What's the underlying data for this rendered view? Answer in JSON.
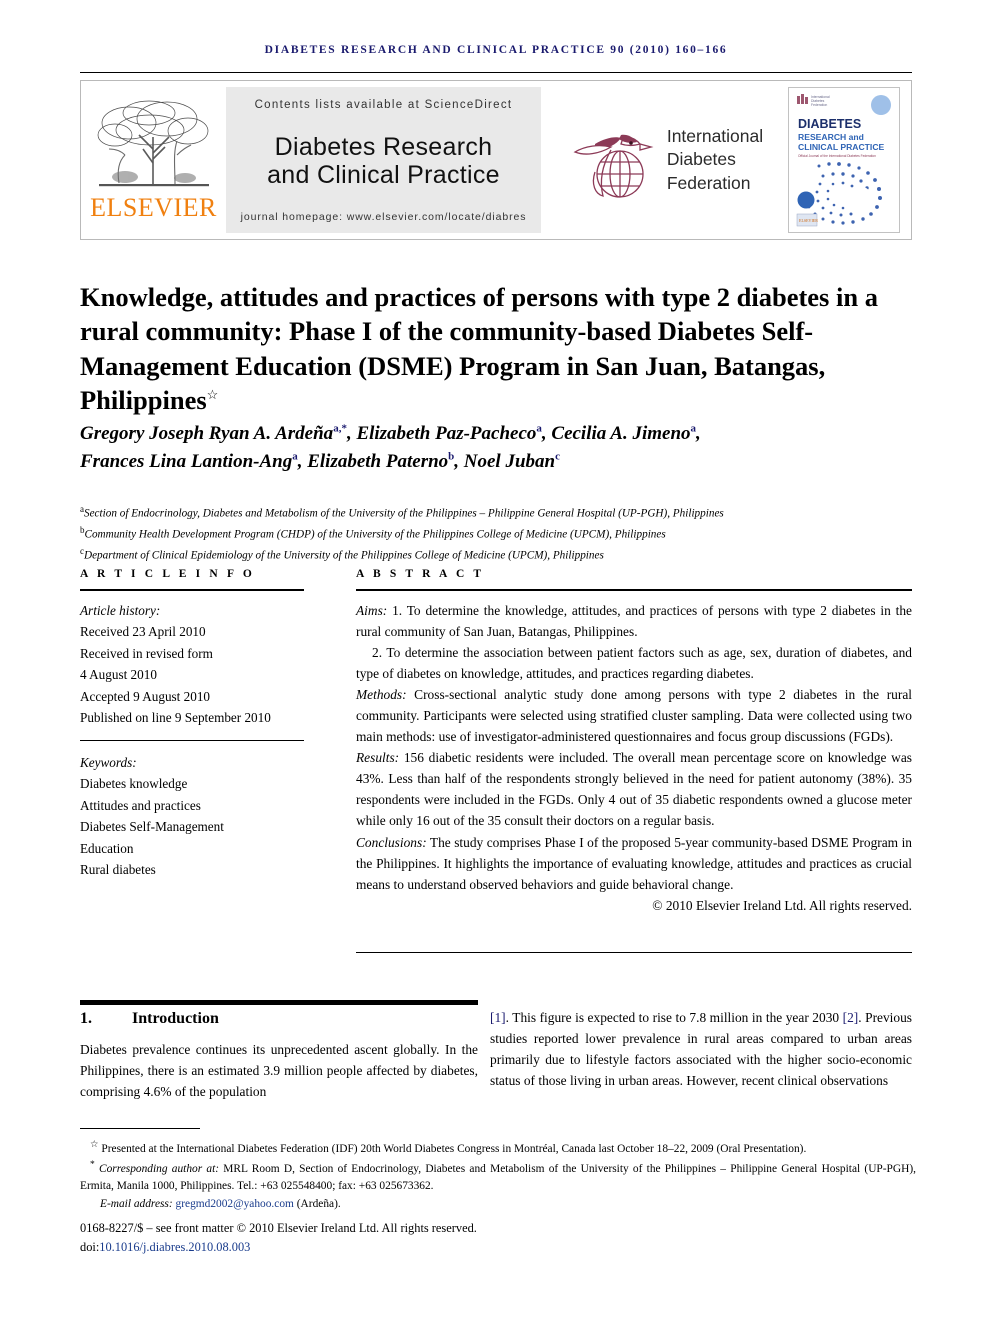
{
  "running_head": "DIABETES RESEARCH AND CLINICAL PRACTICE 90 (2010) 160–166",
  "masthead": {
    "publisher_name": "ELSEVIER",
    "publisher_logo_icon": "elsevier-tree-icon",
    "contents_line": "Contents lists available at ScienceDirect",
    "journal_title_line1": "Diabetes Research",
    "journal_title_line2": "and Clinical Practice",
    "homepage_line": "journal homepage: www.elsevier.com/locate/diabres",
    "society_logo_icon": "idf-bird-globe-icon",
    "society_name_line1": "International",
    "society_name_line2": "Diabetes",
    "society_name_line3": "Federation",
    "cover_icon": "journal-cover-thumbnail",
    "cover_title_line1": "DIABETES",
    "cover_title_line2": "RESEARCH and",
    "cover_title_line3": "CLINICAL PRACTICE",
    "colors": {
      "header_navy": "#1a1a6e",
      "elsevier_orange": "#f08010",
      "idf_maroon": "#8c3a57",
      "mid_panel_gray": "#e9e9e9",
      "cover_blue": "#2a4b9b"
    }
  },
  "article": {
    "title": "Knowledge, attitudes and practices of persons with type 2 diabetes in a rural community: Phase I of the community-based Diabetes Self-Management Education (DSME) Program in San Juan, Batangas, Philippines",
    "title_footnote_marker": "☆",
    "authors_line1": "Gregory Joseph Ryan A. Ardeña",
    "authors": [
      {
        "name": "Gregory Joseph Ryan A. Ardeña",
        "marks": "a,*"
      },
      {
        "name": "Elizabeth Paz-Pacheco",
        "marks": "a"
      },
      {
        "name": "Cecilia A. Jimeno",
        "marks": "a"
      },
      {
        "name": "Frances Lina Lantion-Ang",
        "marks": "a"
      },
      {
        "name": "Elizabeth Paterno",
        "marks": "b"
      },
      {
        "name": "Noel Juban",
        "marks": "c"
      }
    ],
    "affiliations": [
      {
        "mark": "a",
        "text": "Section of Endocrinology, Diabetes and Metabolism of the University of the Philippines – Philippine General Hospital (UP-PGH), Philippines"
      },
      {
        "mark": "b",
        "text": "Community Health Development Program (CHDP) of the University of the Philippines College of Medicine (UPCM), Philippines"
      },
      {
        "mark": "c",
        "text": "Department of Clinical Epidemiology of the University of the Philippines College of Medicine (UPCM), Philippines"
      }
    ]
  },
  "article_info": {
    "heading": "A R T I C L E   I N F O",
    "history_label": "Article history:",
    "history": [
      "Received 23 April 2010",
      "Received in revised form",
      "4 August 2010",
      "Accepted 9 August 2010",
      "Published on line 9 September 2010"
    ],
    "keywords_label": "Keywords:",
    "keywords": [
      "Diabetes knowledge",
      "Attitudes and practices",
      "Diabetes Self-Management",
      "Education",
      "Rural diabetes"
    ]
  },
  "abstract": {
    "heading": "A B S T R A C T",
    "aims_label": "Aims:",
    "aims_1": " 1. To determine the knowledge, attitudes, and practices of persons with type 2 diabetes in the rural community of San Juan, Batangas, Philippines.",
    "aims_2": "2. To determine the association between patient factors such as age, sex, duration of diabetes, and type of diabetes on knowledge, attitudes, and practices regarding diabetes.",
    "methods_label": "Methods:",
    "methods": " Cross-sectional analytic study done among persons with type 2 diabetes in the rural community. Participants were selected using stratified cluster sampling. Data were collected using two main methods: use of investigator-administered questionnaires and focus group discussions (FGDs).",
    "results_label": "Results:",
    "results": " 156 diabetic residents were included. The overall mean percentage score on knowledge was 43%. Less than half of the respondents strongly believed in the need for patient autonomy (38%). 35 respondents were included in the FGDs. Only 4 out of 35 diabetic respondents owned a glucose meter while only 16 out of the 35 consult their doctors on a regular basis.",
    "conclusions_label": "Conclusions:",
    "conclusions": " The study comprises Phase I of the proposed 5-year community-based DSME Program in the Philippines. It highlights the importance of evaluating knowledge, attitudes and practices as crucial means to understand observed behaviors and guide behavioral change.",
    "copyright": "© 2010 Elsevier Ireland Ltd. All rights reserved."
  },
  "body": {
    "section_number": "1.",
    "section_title": "Introduction",
    "left_column": "Diabetes prevalence continues its unprecedented ascent globally. In the Philippines, there is an estimated 3.9 million people affected by diabetes, comprising 4.6% of the population",
    "right_cite_1": "[1]",
    "right_text_1": ". This figure is expected to rise to 7.8 million in the year 2030 ",
    "right_cite_2": "[2]",
    "right_text_2": ". Previous studies reported lower prevalence in rural areas compared to urban areas primarily due to lifestyle factors associated with the higher socio-economic status of those living in urban areas. However, recent clinical observations"
  },
  "footnotes": {
    "star_note": "Presented at the International Diabetes Federation (IDF) 20th World Diabetes Congress in Montréal, Canada last October 18–22, 2009 (Oral Presentation).",
    "star_marker": "☆",
    "corresponding_marker": "*",
    "corresponding_label": "Corresponding author at:",
    "corresponding_text": " MRL Room D, Section of Endocrinology, Diabetes and Metabolism of the University of the Philippines – Philippine General Hospital (UP-PGH), Ermita, Manila 1000, Philippines. Tel.: +63 025548400; fax: +63 025673362.",
    "email_label": "E-mail address:",
    "email": "gregmd2002@yahoo.com",
    "email_suffix": " (Ardeña).",
    "issn_line": "0168-8227/$ – see front matter © 2010 Elsevier Ireland Ltd. All rights reserved.",
    "doi_label": "doi:",
    "doi": "10.1016/j.diabres.2010.08.003"
  }
}
